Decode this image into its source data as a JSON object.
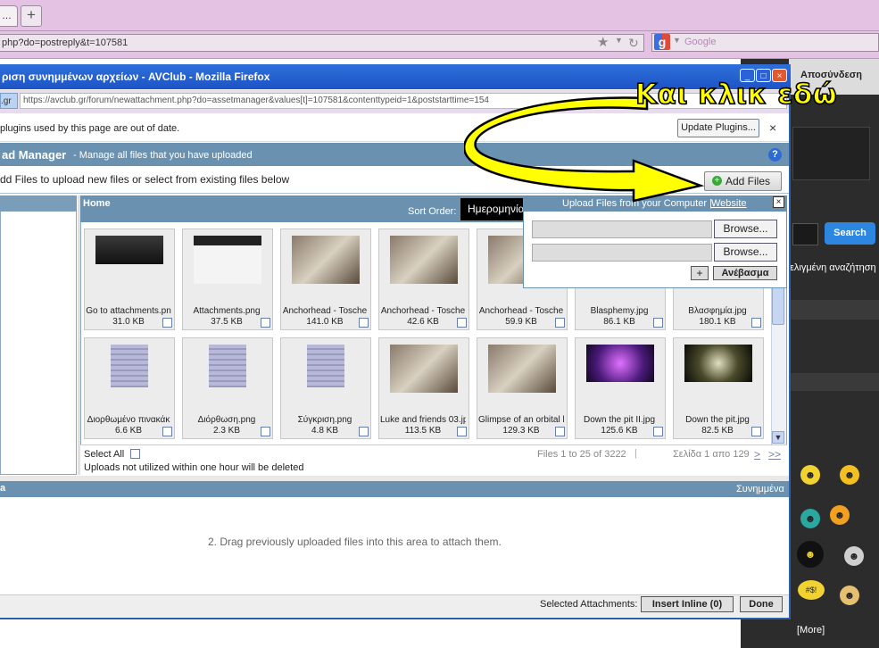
{
  "outer_browser": {
    "tab_label": "…",
    "new_tab": "+",
    "url": "php?do=postreply&t=107581",
    "search_engine": "Google"
  },
  "inner_window": {
    "title": "ριση συνημμένων αρχείων - AVClub - Mozilla Firefox",
    "site_id": ".gr",
    "url": "https://avclub.gr/forum/newattachment.php?do=assetmanager&values[t]=107581&contenttypeid=1&poststarttime=154",
    "window_buttons": {
      "minimize": "_",
      "maximize": "□",
      "close": "×"
    }
  },
  "plugin_notice": {
    "text": "plugins used by this page are out of date.",
    "button": "Update Plugins...",
    "close": "×"
  },
  "upload_manager": {
    "title": "ad Manager",
    "subtitle": "- Manage all files that you have uploaded",
    "help": "?",
    "instruction": "dd Files to upload new files or select from existing files below",
    "add_files": "Add Files",
    "add_icon": "+"
  },
  "grid": {
    "folder": "Home",
    "sort_label": "Sort Order:",
    "sort_value": "Ημερομηνία",
    "files": [
      {
        "name": "Go to attachments.pn",
        "size": "31.0 KB",
        "thumb": "dark-screenshot"
      },
      {
        "name": "Attachments.png",
        "size": "37.5 KB",
        "thumb": "screenshot"
      },
      {
        "name": "Anchorhead - Tosche",
        "size": "141.0 KB",
        "thumb": "photo"
      },
      {
        "name": "Anchorhead - Tosche",
        "size": "42.6 KB",
        "thumb": "photo"
      },
      {
        "name": "Anchorhead - Tosche",
        "size": "59.9 KB",
        "thumb": "photo"
      },
      {
        "name": "Blasphemy.jpg",
        "size": "86.1 KB",
        "thumb": "photo"
      },
      {
        "name": "Βλασφημία.jpg",
        "size": "180.1 KB",
        "thumb": "photo"
      },
      {
        "name": "Διορθωμένο πινακάκ",
        "size": "6.6 KB",
        "thumb": "document"
      },
      {
        "name": "Διόρθωση.png",
        "size": "2.3 KB",
        "thumb": "document"
      },
      {
        "name": "Σύγκριση.png",
        "size": "4.8 KB",
        "thumb": "document"
      },
      {
        "name": "Luke and friends 03.jp",
        "size": "113.5 KB",
        "thumb": "photo"
      },
      {
        "name": "Glimpse of an orbital b",
        "size": "129.3 KB",
        "thumb": "photo"
      },
      {
        "name": "Down the pit II.jpg",
        "size": "125.6 KB",
        "thumb": "purple-art"
      },
      {
        "name": "Down the pit.jpg",
        "size": "82.5 KB",
        "thumb": "dark-art"
      }
    ],
    "select_all": "Select All",
    "uploads_note": "Uploads not utilized within one hour will be deleted",
    "files_count": "Files 1 to 25 of 3222",
    "page_info": "Σελίδα 1 απο 129",
    "next": ">",
    "last": ">>"
  },
  "upload_popup": {
    "title": "Upload Files from your Computer |",
    "website": "Website",
    "close": "×",
    "browse1": "Browse...",
    "browse2": "Browse...",
    "plus": "+",
    "upload": "Ανέβασμα"
  },
  "attachments": {
    "header_left": "a",
    "header_right": "Συνημμένα",
    "drag_note": "2. Drag previously uploaded files into this area to attach them.",
    "selected_label": "Selected Attachments:",
    "insert_inline": "Insert Inline (0)",
    "done": "Done"
  },
  "right_panel": {
    "logout": "Αποσύνδεση",
    "search": "Search",
    "advanced_search": "ελιγμένη αναζήτηση",
    "more": "[More]"
  },
  "annotation": {
    "text": "Και κλικ εδώ",
    "color": "#ffff00"
  }
}
